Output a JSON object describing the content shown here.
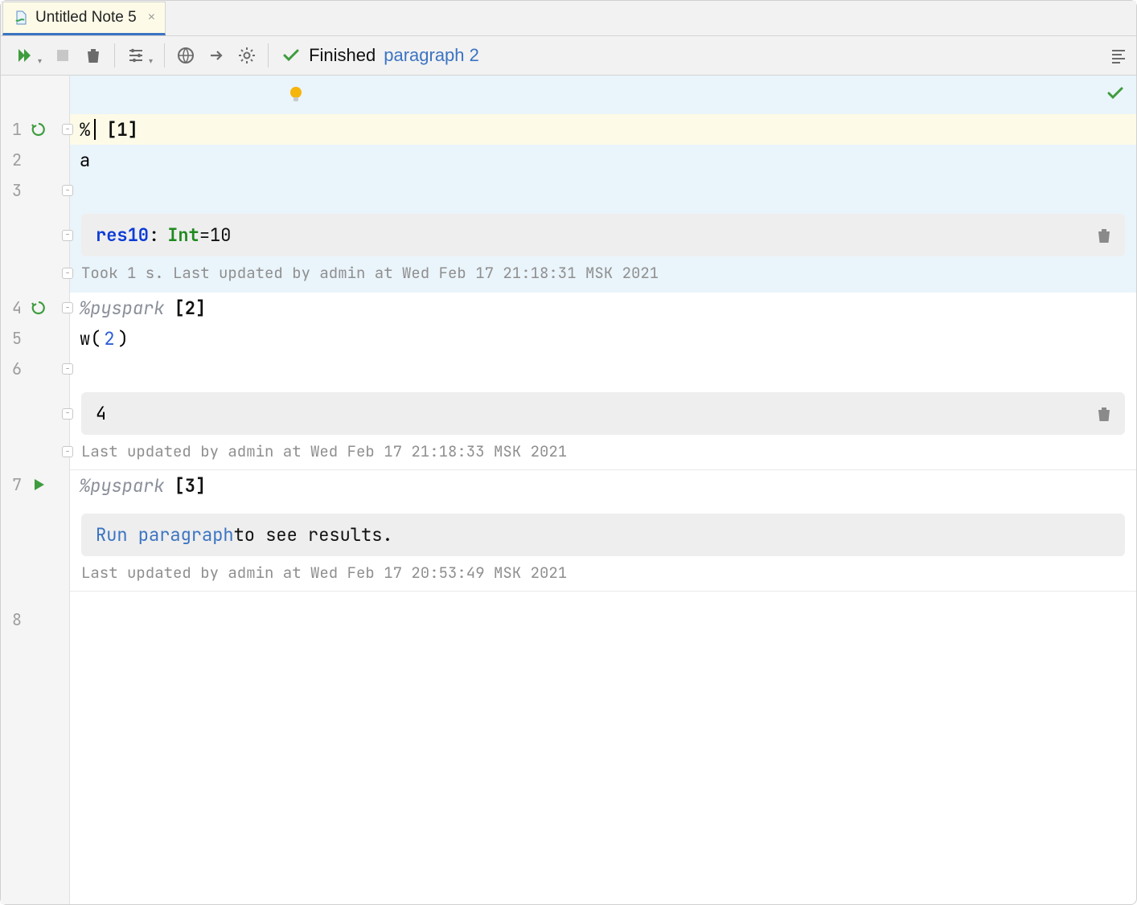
{
  "tab": {
    "title": "Untitled Note 5"
  },
  "status": {
    "label": "Finished",
    "paragraph": "paragraph 2"
  },
  "gutter": {
    "l1": "1",
    "l2": "2",
    "l3": "3",
    "l4": "4",
    "l5": "5",
    "l6": "6",
    "l7": "7",
    "l8": "8"
  },
  "cell1": {
    "interp_prefix": "%",
    "index": "[1]",
    "code_line": "a",
    "output": {
      "name": "res10",
      "colon": ":",
      "type": "Int",
      "eq": " = ",
      "value": "10"
    },
    "meta": "Took 1 s. Last updated by admin at Wed Feb 17 21:18:31 MSK 2021"
  },
  "cell2": {
    "interp": "%pyspark",
    "index": "[2]",
    "code_prefix": "w(",
    "code_arg": "2",
    "code_suffix": ")",
    "output": "4",
    "meta": "Last updated by admin at Wed Feb 17 21:18:33 MSK 2021"
  },
  "cell3": {
    "interp": "%pyspark",
    "index": "[3]",
    "run_link": "Run paragraph",
    "run_rest": " to see results.",
    "meta": "Last updated by admin at Wed Feb 17 20:53:49 MSK 2021"
  }
}
